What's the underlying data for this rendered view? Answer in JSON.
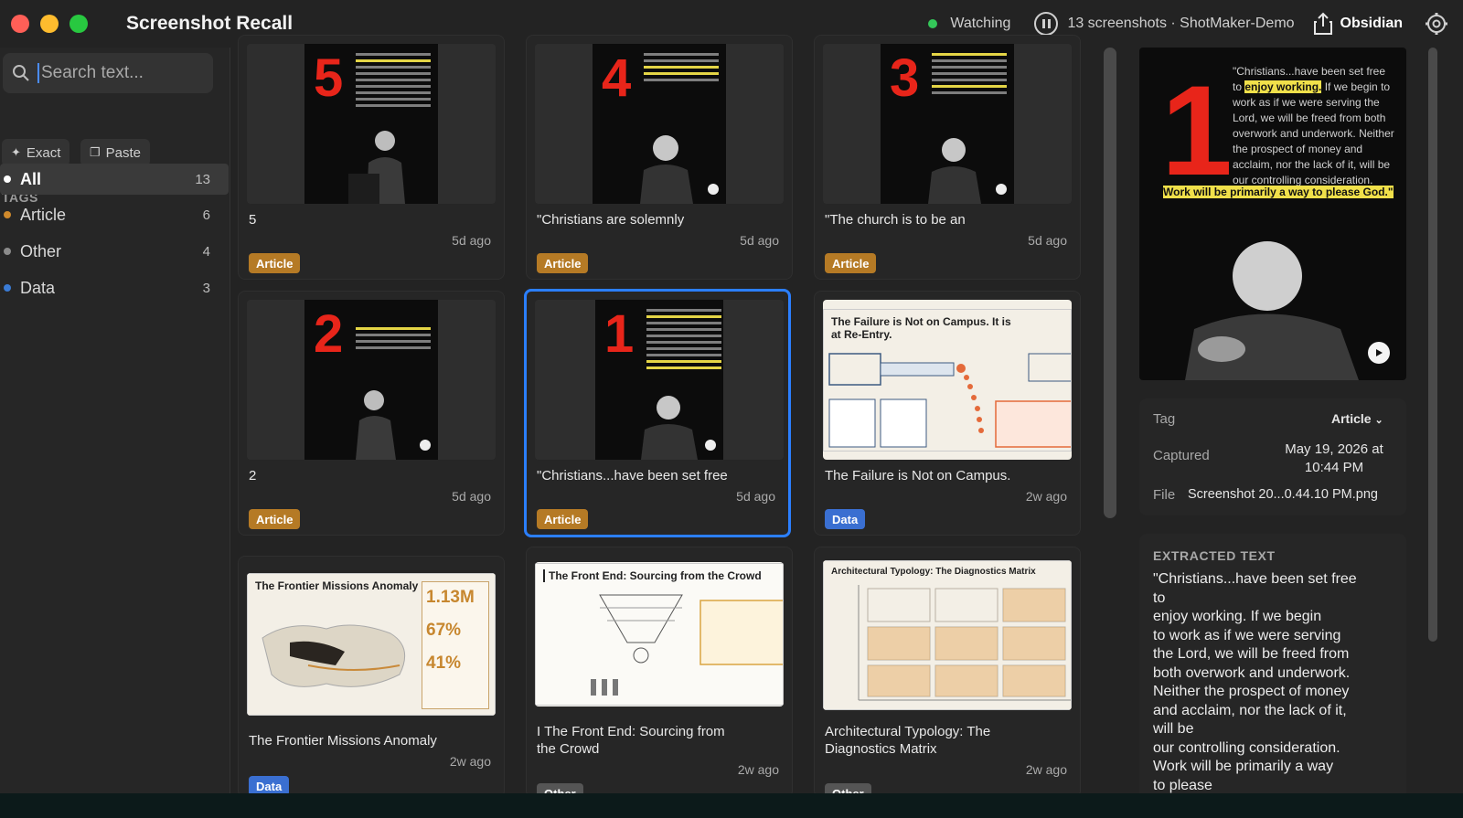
{
  "window": {
    "title": "Screenshot Recall"
  },
  "toolbar": {
    "watch_status": "Watching",
    "summary": "13 screenshots · ShotMaker-Demo",
    "export_label": "Obsidian"
  },
  "sidebar": {
    "search_placeholder": "Search text...",
    "exact_label": "Exact",
    "paste_label": "Paste",
    "tags_heading": "TAGS",
    "tags": [
      {
        "label": "All",
        "count": "13",
        "color": "#ffffff"
      },
      {
        "label": "Article",
        "count": "6",
        "color": "#d08a2c"
      },
      {
        "label": "Other",
        "count": "4",
        "color": "#8a8a8a"
      },
      {
        "label": "Data",
        "count": "3",
        "color": "#3a7bd5"
      }
    ]
  },
  "cards": [
    {
      "title": "5",
      "age": "5d ago",
      "tag": "Article",
      "num": "5"
    },
    {
      "title": "\"Christians are solemnly",
      "age": "5d ago",
      "tag": "Article",
      "num": "4"
    },
    {
      "title": "\"The church is to be an",
      "age": "5d ago",
      "tag": "Article",
      "num": "3"
    },
    {
      "title": "2",
      "age": "5d ago",
      "tag": "Article",
      "num": "2"
    },
    {
      "title": "\"Christians...have been set free",
      "age": "5d ago",
      "tag": "Article",
      "num": "1"
    },
    {
      "title": "The Failure is Not on Campus.",
      "age": "2w ago",
      "tag": "Data",
      "heading": "The Failure is Not on Campus. It is at Re-Entry."
    },
    {
      "title": "The Frontier Missions Anomaly",
      "age": "2w ago",
      "tag": "Data",
      "heading": "The Frontier Missions Anomaly",
      "stats": [
        "1.13M",
        "67%",
        "41%"
      ]
    },
    {
      "title": "I The Front End: Sourcing from the Crowd",
      "age": "2w ago",
      "tag": "Other",
      "heading": "The Front End: Sourcing from the Crowd"
    },
    {
      "title": "Architectural Typology: The Diagnostics Matrix",
      "age": "2w ago",
      "tag": "Other",
      "heading": "Architectural Typology: The Diagnostics Matrix"
    }
  ],
  "detail": {
    "preview_num": "1",
    "preview_text_a": "\"Christians...have been set free to ",
    "preview_hl_a": "enjoy working.",
    "preview_text_b": " If we begin to work as if we were serving the Lord, we will be freed from both overwork and underwork. Neither the prospect of money and acclaim, nor the lack of it, will be our controlling consideration.",
    "preview_hl_b": "Work will be primarily a way to please God.\"",
    "tag_key": "Tag",
    "tag_value": "Article",
    "captured_key": "Captured",
    "captured_value": "May 19, 2026 at 10:44 PM",
    "file_key": "File",
    "file_value": "Screenshot 20...0.44.10 PM.png",
    "extracted_heading": "EXTRACTED TEXT",
    "extracted_text": "\"Christians...have been set free\nto\nenjoy working. If we begin\nto work as if we were serving\nthe Lord, we will be freed from\nboth overwork and underwork.\nNeither the prospect of money\nand acclaim, nor the lack of it,\nwill be\nour controlling consideration.\nWork will be primarily a way\nto please"
  }
}
